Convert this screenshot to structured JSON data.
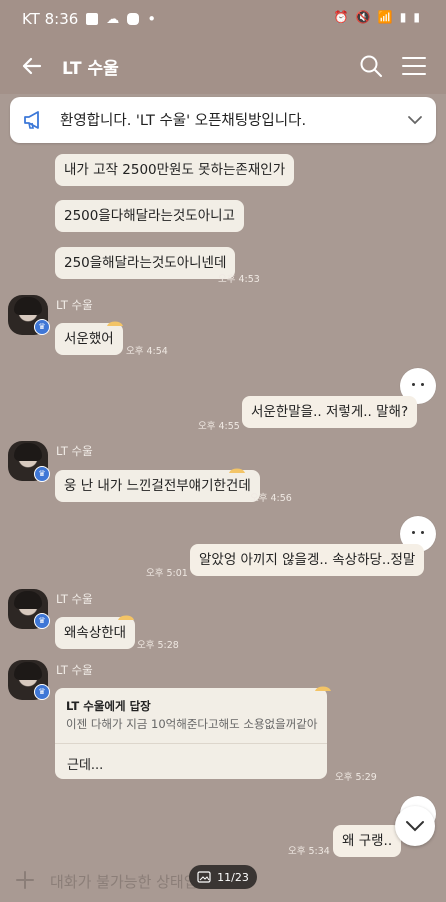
{
  "status_bar": {
    "carrier_time": "KT 8:36",
    "dot": "•"
  },
  "header": {
    "title": "LT 수울"
  },
  "notice": {
    "text": "환영합니다. 'LT 수울' 오픈채팅방입니다."
  },
  "messages": {
    "m1": "내가 고작 2500만원도 못하는존재인가",
    "m2": "2500을다해달라는것도아니고",
    "m3": "250을해달라는것도아니넨데",
    "t3": "오후 4:53",
    "sender": "LT 수울",
    "m4": "서운했어",
    "t4": "오후 4:54",
    "m5": "서운한말을.. 저렇게.. 말해?",
    "t5": "오후 4:55",
    "m6": "웅 난 내가 느낀걸전부얘기한건데",
    "t6": "오후 4:56",
    "m7": "알았엉 아끼지 않을겡.. 속상하당..정말",
    "t7": "오후 5:01",
    "m8": "왜속상한대",
    "t8": "오후 5:28",
    "reply_title": "LT 수울에게 답장",
    "reply_quote": "이젠 다해가 지금 10억해준다고해도 소용없을꺼같아",
    "reply_body": "근데...",
    "t9": "오후 5:29",
    "m10": "왜 구랭..",
    "t10": "오후 5:34"
  },
  "input": {
    "placeholder": "대화가 불가능한 상태입"
  },
  "pager": {
    "text": "11/23"
  }
}
